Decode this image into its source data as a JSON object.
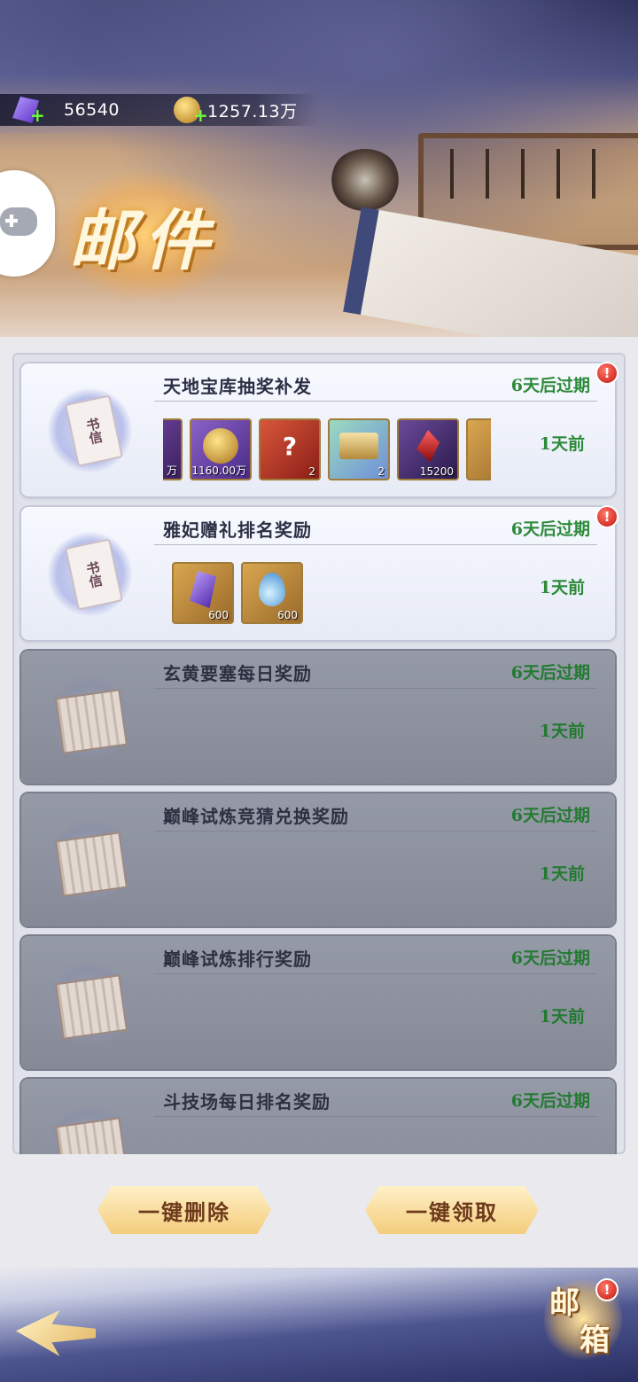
{
  "resources": {
    "gems": "56540",
    "gold": "1257.13万"
  },
  "title": "邮件",
  "mails": [
    {
      "subject": "天地宝库抽奖补发",
      "expire": "6天后过期",
      "age": "1天前",
      "state": "unread",
      "has_badge": true,
      "items": [
        {
          "icon": "gold-coin-icon",
          "qty": "万"
        },
        {
          "icon": "gold-coin-icon",
          "qty": "1160.00万"
        },
        {
          "icon": "mystery-box-icon",
          "qty": "2"
        },
        {
          "icon": "treasure-chest-icon",
          "qty": "2"
        },
        {
          "icon": "red-crystal-icon",
          "qty": "15200"
        },
        {
          "icon": "water-drop-icon",
          "qty": ""
        }
      ]
    },
    {
      "subject": "雅妃赠礼排名奖励",
      "expire": "6天后过期",
      "age": "1天前",
      "state": "unread",
      "has_badge": true,
      "items": [
        {
          "icon": "purple-gem-icon",
          "qty": "600"
        },
        {
          "icon": "water-drop-icon",
          "qty": "600"
        }
      ]
    },
    {
      "subject": "玄黄要塞每日奖励",
      "expire": "6天后过期",
      "age": "1天前",
      "state": "read"
    },
    {
      "subject": "巅峰试炼竞猜兑换奖励",
      "expire": "6天后过期",
      "age": "1天前",
      "state": "read"
    },
    {
      "subject": "巅峰试炼排行奖励",
      "expire": "6天后过期",
      "age": "1天前",
      "state": "read"
    },
    {
      "subject": "斗技场每日排名奖励",
      "expire": "6天后过期",
      "age": "",
      "state": "read"
    }
  ],
  "letter_glyph": "书信",
  "badge_glyph": "!",
  "buttons": {
    "delete_all": "一键删除",
    "claim_all": "一键领取"
  },
  "mailbox": {
    "char1": "邮",
    "char2": "箱"
  },
  "colors": {
    "expire_green": "#2d8a3a",
    "button_text": "#6d3a1c",
    "badge_red": "#c4120c"
  }
}
